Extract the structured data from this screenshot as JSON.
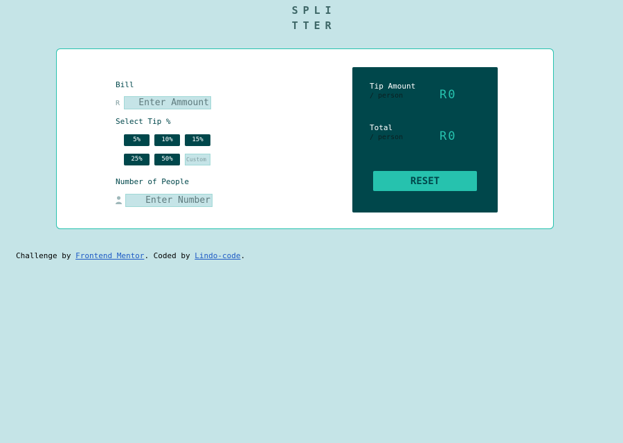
{
  "logo": {
    "line1": "SPLI",
    "line2": "TTER"
  },
  "form": {
    "bill_label": "Bill",
    "currency_symbol": "R",
    "bill_placeholder": "Enter Ammount",
    "tip_label": "Select Tip %",
    "tips": [
      "5%",
      "10%",
      "15%",
      "25%",
      "50%"
    ],
    "custom_placeholder": "Custom",
    "people_label": "Number of People",
    "people_placeholder": "Enter Number",
    "person_icon": "person-icon"
  },
  "results": {
    "tip_title": "Tip Amount",
    "tip_sub": "/ person",
    "tip_value": "R0",
    "total_title": "Total",
    "total_sub": "/ person",
    "total_value": "R0",
    "reset_label": "RESET"
  },
  "attribution": {
    "prefix": "Challenge by ",
    "link1": "Frontend Mentor",
    "middle": ". Coded by ",
    "link2": "Lindo-code",
    "suffix": "."
  },
  "colors": {
    "background": "#c5e4e7",
    "dark_teal": "#00474b",
    "accent": "#26c2ae",
    "white": "#ffffff"
  }
}
